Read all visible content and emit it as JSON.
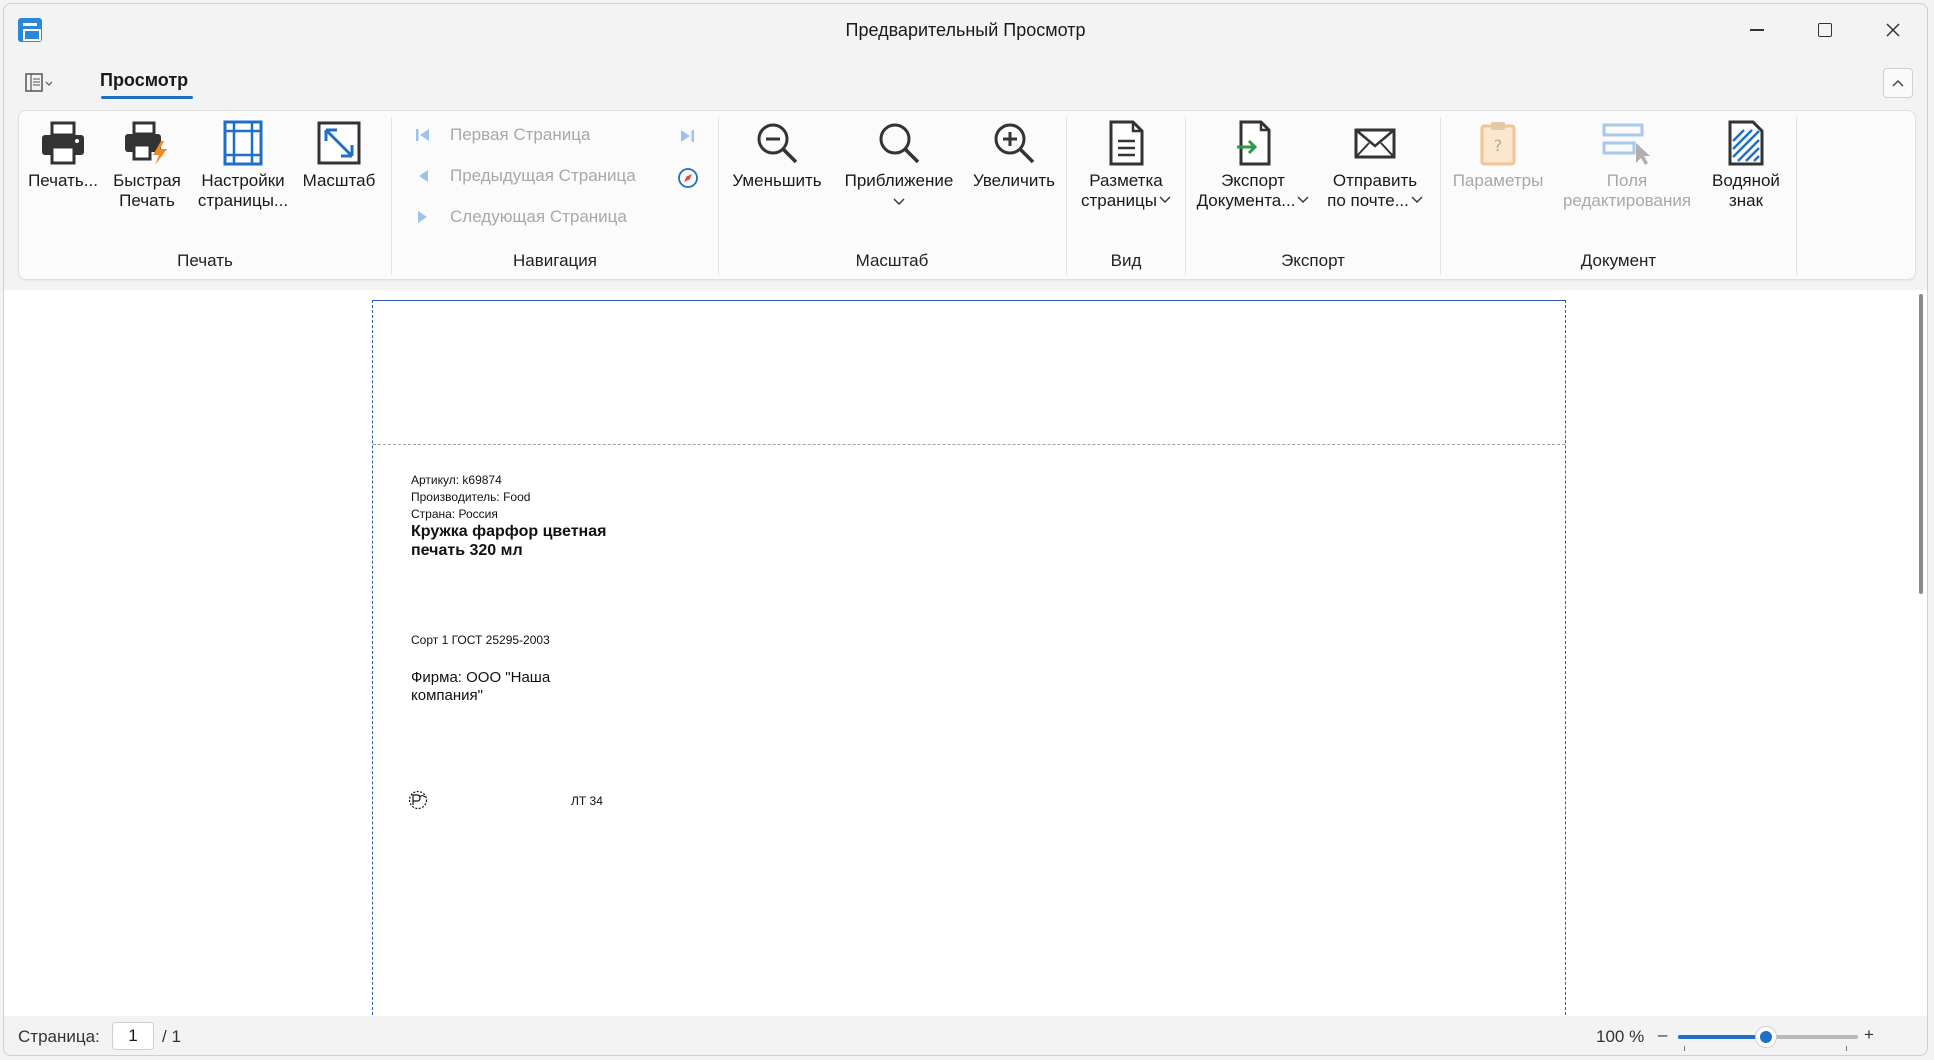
{
  "window": {
    "title": "Предварительный Просмотр"
  },
  "tabs": {
    "active": "Просмотр"
  },
  "ribbon": {
    "groups": {
      "print": {
        "label": "Печать",
        "buttons": {
          "print": "Печать...",
          "quick_print_1": "Быстрая",
          "quick_print_2": "Печать",
          "page_setup_1": "Настройки",
          "page_setup_2": "страницы...",
          "scale": "Масштаб"
        }
      },
      "navigation": {
        "label": "Навигация",
        "first": "Первая Страница",
        "prev": "Предыдущая Страница",
        "next": "Следующая Страница"
      },
      "zoom": {
        "label": "Масштаб",
        "zoom_out": "Уменьшить",
        "zoom": "Приближение",
        "zoom_in": "Увеличить"
      },
      "view": {
        "label": "Вид",
        "page_layout_1": "Разметка",
        "page_layout_2": "страницы"
      },
      "export": {
        "label": "Экспорт",
        "export_doc_1": "Экспорт",
        "export_doc_2": "Документа...",
        "send_mail_1": "Отправить",
        "send_mail_2": "по почте..."
      },
      "document": {
        "label": "Документ",
        "parameters": "Параметры",
        "edit_fields_1": "Поля",
        "edit_fields_2": "редактирования",
        "watermark_1": "Водяной",
        "watermark_2": "знак"
      }
    }
  },
  "document": {
    "article": "Артикул: k69874",
    "manufacturer": "Производитель: Food",
    "country": "Страна: Россия",
    "product_name": "Кружка фарфор цветная печать 320 мл",
    "grade": "Сорт 1 ГОСТ 25295-2003",
    "firm": "Фирма: ООО \"Наша компания\"",
    "lt": "ЛТ 34"
  },
  "statusbar": {
    "page_label": "Страница:",
    "page_current": "1",
    "page_total": "/ 1",
    "zoom_text": "100 %",
    "zoom_minus": "–",
    "zoom_plus": "+",
    "zoom_level_fraction": 0.49
  },
  "colors": {
    "accent": "#1f6fc5",
    "page_border": "#2a5db0",
    "disabled_text": "#a8a8a8"
  }
}
